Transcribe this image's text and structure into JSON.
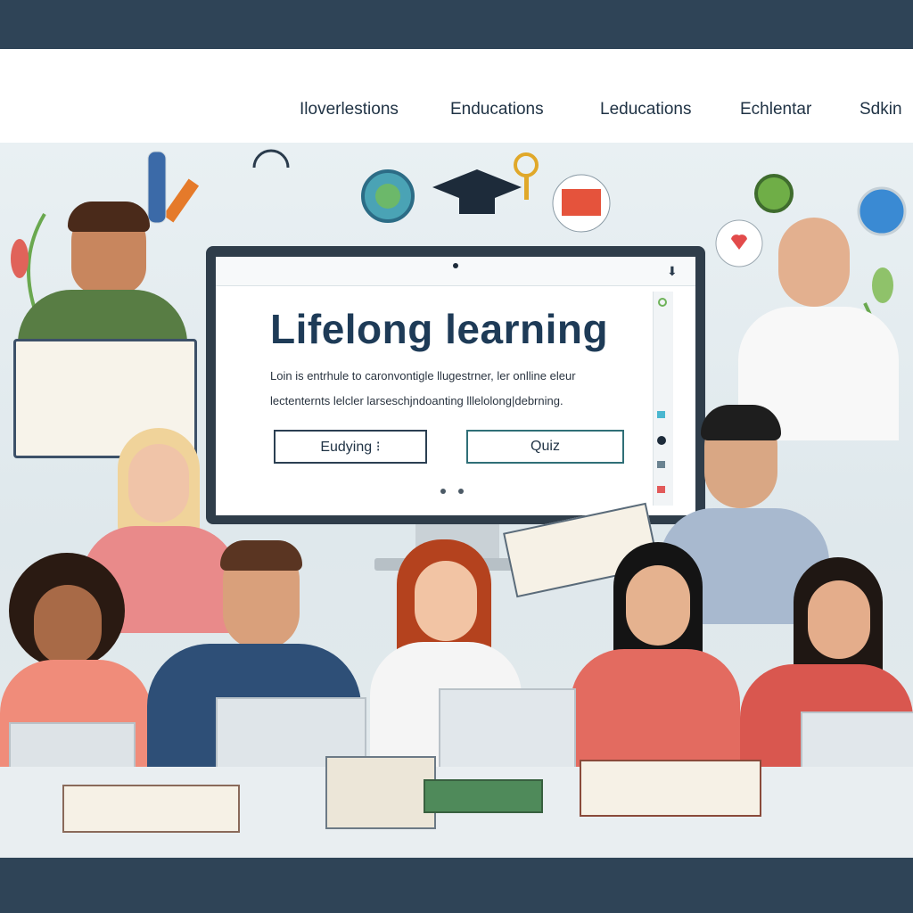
{
  "nav": {
    "items": [
      "Iloverlestions",
      "Enducations",
      "Leducations",
      "Echlentar",
      "Sdkin"
    ]
  },
  "hero": {
    "headline": "Lifelong learning",
    "body_line_1": "Loin is entrhule to caronvontigle llugestrner, ler onlline  eleur",
    "body_line_2": "lectenternts lelcler larseschjndoanting lllelolong|debrning."
  },
  "buttons": {
    "primary_label": "Eudying  ⁝",
    "secondary_label": "Quiz"
  },
  "colors": {
    "frame": "#2f4457",
    "headline": "#1e3b57",
    "accent_teal": "#2f6f77",
    "scene_bg": "#e9f0f3"
  }
}
